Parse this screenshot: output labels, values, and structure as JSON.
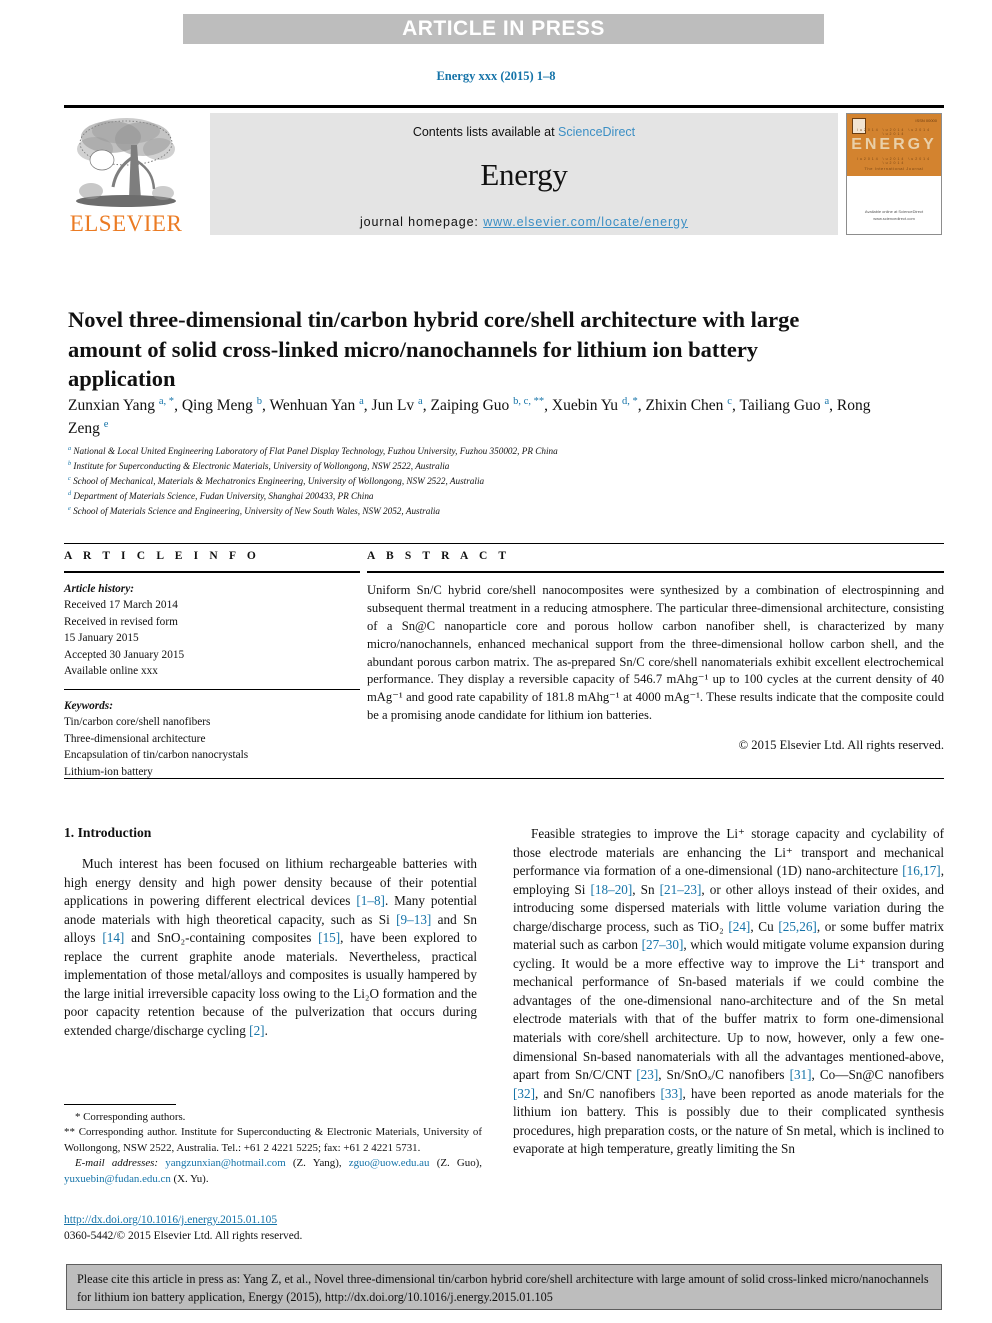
{
  "banner": {
    "text": "ARTICLE IN PRESS"
  },
  "running_head": "Energy xxx (2015) 1–8",
  "masthead": {
    "contents_prefix": "Contents lists available at ",
    "contents_link": "ScienceDirect",
    "journal_name": "Energy",
    "homepage_prefix": "journal homepage: ",
    "homepage_url": "www.elsevier.com/locate/energy",
    "publisher_logo_text": "ELSEVIER",
    "cover_title": "ENERGY",
    "cover_subtitle": "The International Journal",
    "cover_corner": "ISSN 00000",
    "cover_footer": "Available online at\nScienceDirect\nwww.sciencedirect.com"
  },
  "article": {
    "title": "Novel three-dimensional tin/carbon hybrid core/shell architecture with large amount of solid cross-linked micro/nanochannels for lithium ion battery application",
    "authors": [
      {
        "name": "Zunxian Yang",
        "marks": "a, *"
      },
      {
        "name": "Qing Meng",
        "marks": "b"
      },
      {
        "name": "Wenhuan Yan",
        "marks": "a"
      },
      {
        "name": "Jun Lv",
        "marks": "a"
      },
      {
        "name": "Zaiping Guo",
        "marks": "b, c, **"
      },
      {
        "name": "Xuebin Yu",
        "marks": "d, *"
      },
      {
        "name": "Zhixin Chen",
        "marks": "c"
      },
      {
        "name": "Tailiang Guo",
        "marks": "a"
      },
      {
        "name": "Rong Zeng",
        "marks": "e"
      }
    ],
    "affiliations": [
      {
        "mark": "a",
        "text": "National & Local United Engineering Laboratory of Flat Panel Display Technology, Fuzhou University, Fuzhou 350002, PR China"
      },
      {
        "mark": "b",
        "text": "Institute for Superconducting & Electronic Materials, University of Wollongong, NSW 2522, Australia"
      },
      {
        "mark": "c",
        "text": "School of Mechanical, Materials & Mechatronics Engineering, University of Wollongong, NSW 2522, Australia"
      },
      {
        "mark": "d",
        "text": "Department of Materials Science, Fudan University, Shanghai 200433, PR China"
      },
      {
        "mark": "e",
        "text": "School of Materials Science and Engineering, University of New South Wales, NSW 2052, Australia"
      }
    ]
  },
  "article_info": {
    "heading": "A R T I C L E  I N F O",
    "history_label": "Article history:",
    "history": [
      "Received 17 March 2014",
      "Received in revised form",
      "15 January 2015",
      "Accepted 30 January 2015",
      "Available online xxx"
    ],
    "keywords_label": "Keywords:",
    "keywords": [
      "Tin/carbon core/shell nanofibers",
      "Three-dimensional architecture",
      "Encapsulation of tin/carbon nanocrystals",
      "Lithium-ion battery"
    ]
  },
  "abstract": {
    "heading": "A B S T R A C T",
    "body": "Uniform Sn/C hybrid core/shell nanocomposites were synthesized by a combination of electrospinning and subsequent thermal treatment in a reducing atmosphere. The particular three-dimensional architecture, consisting of a Sn@C nanoparticle core and porous hollow carbon nanofiber shell, is characterized by many micro/nanochannels, enhanced mechanical support from the three-dimensional hollow carbon shell, and the abundant porous carbon matrix. The as-prepared Sn/C core/shell nanomaterials exhibit excellent electrochemical performance. They display a reversible capacity of 546.7 mAhg⁻¹ up to 100 cycles at the current density of 40 mAg⁻¹ and good rate capability of 181.8 mAhg⁻¹ at 4000 mAg⁻¹. These results indicate that the composite could be a promising anode candidate for lithium ion batteries.",
    "copyright": "© 2015 Elsevier Ltd. All rights reserved."
  },
  "body": {
    "section_heading": "1. Introduction",
    "left_paragraph": "Much interest has been focused on lithium rechargeable batteries with high energy density and high power density because of their potential applications in powering different electrical devices [1–8]. Many potential anode materials with high theoretical capacity, such as Si [9–13] and Sn alloys [14] and SnO₂-containing composites [15], have been explored to replace the current graphite anode materials. Nevertheless, practical implementation of those metal/alloys and composites is usually hampered by the large initial irreversible capacity loss owing to the Li₂O formation and the poor capacity retention because of the pulverization that occurs during extended charge/discharge cycling [2].",
    "right_paragraph": "Feasible strategies to improve the Li⁺ storage capacity and cyclability of those electrode materials are enhancing the Li⁺ transport and mechanical performance via formation of a one-dimensional (1D) nano-architecture [16,17], employing Si [18–20], Sn [21–23], or other alloys instead of their oxides, and introducing some dispersed materials with little volume variation during the charge/discharge process, such as TiO₂ [24], Cu [25,26], or some buffer matrix material such as carbon [27–30], which would mitigate volume expansion during cycling. It would be a more effective way to improve the Li⁺ transport and mechanical performance of Sn-based materials if we could combine the advantages of the one-dimensional nano-architecture and of the Sn metal electrode materials with that of the buffer matrix to form one-dimensional materials with core/shell architecture. Up to now, however, only a few one-dimensional Sn-based nanomaterials with all the advantages mentioned-above, apart from Sn/C/CNT [23], Sn/SnOₓ/C nanofibers [31], Co—Sn@C nanofibers [32], and Sn/C nanofibers [33], have been reported as anode materials for the lithium ion battery. This is possibly due to their complicated synthesis procedures, high preparation costs, or the nature of Sn metal, which is inclined to evaporate at high temperature, greatly limiting the Sn"
  },
  "footnotes": {
    "corresponding_1": "* Corresponding authors.",
    "corresponding_2": "** Corresponding author. Institute for Superconducting & Electronic Materials, University of Wollongong, NSW 2522, Australia. Tel.: +61 2 4221 5225; fax: +61 2 4221 5731.",
    "email_label": "E-mail addresses:",
    "emails": [
      {
        "address": "yangzunxian@hotmail.com",
        "owner": "(Z. Yang)"
      },
      {
        "address": "zguo@uow.edu.au",
        "owner": "(Z. Guo)"
      },
      {
        "address": "yuxuebin@fudan.edu.cn",
        "owner": "(X. Yu)"
      }
    ],
    "doi": "http://dx.doi.org/10.1016/j.energy.2015.01.105",
    "issn_line": "0360-5442/© 2015 Elsevier Ltd. All rights reserved."
  },
  "cite_footer": {
    "text": "Please cite this article in press as: Yang Z, et al., Novel three-dimensional tin/carbon hybrid core/shell architecture with large amount of solid cross-linked micro/nanochannels for lithium ion battery application, Energy (2015), http://dx.doi.org/10.1016/j.energy.2015.01.105"
  },
  "colors": {
    "link_blue": "#1573a8",
    "sciencedirect_blue": "#3c8fc4",
    "elsevier_orange": "#eb7b23",
    "banner_gray": "#bdbdbd",
    "masthead_gray": "#e4e4e4",
    "cover_orange": "#d3832f"
  }
}
